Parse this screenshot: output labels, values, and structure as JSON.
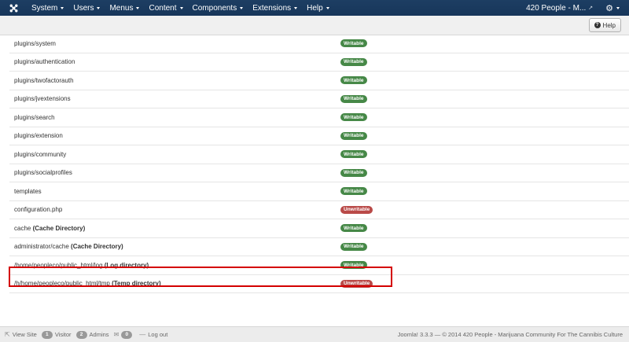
{
  "navbar": {
    "menu": [
      {
        "label": "System"
      },
      {
        "label": "Users"
      },
      {
        "label": "Menus"
      },
      {
        "label": "Content"
      },
      {
        "label": "Components"
      },
      {
        "label": "Extensions"
      },
      {
        "label": "Help"
      }
    ],
    "site_name": "420 People - M...",
    "icons": {
      "brand": "joomla-logo-icon",
      "external": "external-link-icon",
      "settings": "gear-icon"
    }
  },
  "toolbar": {
    "help_label": "Help",
    "help_icon": "question-circle-icon"
  },
  "directories": [
    {
      "path": "plugins/system",
      "suffix": "",
      "status": "Writable"
    },
    {
      "path": "plugins/authentication",
      "suffix": "",
      "status": "Writable"
    },
    {
      "path": "plugins/twofactorauth",
      "suffix": "",
      "status": "Writable"
    },
    {
      "path": "plugins/jvextensions",
      "suffix": "",
      "status": "Writable"
    },
    {
      "path": "plugins/search",
      "suffix": "",
      "status": "Writable"
    },
    {
      "path": "plugins/extension",
      "suffix": "",
      "status": "Writable"
    },
    {
      "path": "plugins/community",
      "suffix": "",
      "status": "Writable"
    },
    {
      "path": "plugins/socialprofiles",
      "suffix": "",
      "status": "Writable"
    },
    {
      "path": "templates",
      "suffix": "",
      "status": "Writable"
    },
    {
      "path": "configuration.php",
      "suffix": "",
      "status": "Unwritable"
    },
    {
      "path": "cache ",
      "suffix": "(Cache Directory)",
      "status": "Writable"
    },
    {
      "path": "administrator/cache ",
      "suffix": "(Cache Directory)",
      "status": "Writable"
    },
    {
      "path": "/home/peopleco/public_html/log ",
      "suffix": "(Log directory)",
      "status": "Writable"
    },
    {
      "path": "/h/home/peopleco/public_html/tmp ",
      "suffix": "(Temp directory)",
      "status": "Unwritable"
    }
  ],
  "status_colors": {
    "Writable": "#468847",
    "Unwritable": "#b94a48"
  },
  "highlight_color": "#d40000",
  "footer": {
    "view_site": "View Site",
    "visitor_count": "1",
    "visitor_label": "Visitor",
    "admin_count": "2",
    "admin_label": "Admins",
    "message_count": "0",
    "logout": "Log out",
    "copyright": "Joomla! 3.3.3  —  © 2014 420 People - Marijuana Community For The Cannibis Culture"
  }
}
